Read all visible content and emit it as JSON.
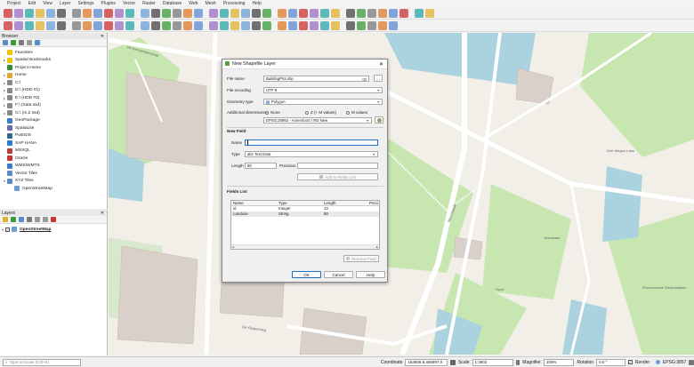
{
  "menu": [
    "Project",
    "Edit",
    "View",
    "Layer",
    "Settings",
    "Plugins",
    "Vector",
    "Raster",
    "Database",
    "Web",
    "Mesh",
    "Processing",
    "Help"
  ],
  "browser": {
    "title": "Browser",
    "items": [
      {
        "label": "Favorites",
        "color": "#f2c200",
        "indent": 0,
        "arrow": ""
      },
      {
        "label": "Spatial Bookmarks",
        "color": "#f2c200",
        "indent": 0,
        "arrow": "▸"
      },
      {
        "label": "Project Home",
        "color": "#3a8e3a",
        "indent": 0,
        "arrow": ""
      },
      {
        "label": "Home",
        "color": "#e3a43a",
        "indent": 0,
        "arrow": "▸"
      },
      {
        "label": "C:\\",
        "color": "#888",
        "indent": 0,
        "arrow": "▸"
      },
      {
        "label": "D:\\ (HDD #1)",
        "color": "#888",
        "indent": 0,
        "arrow": "▸"
      },
      {
        "label": "E:\\ (HDD #2)",
        "color": "#888",
        "indent": 0,
        "arrow": "▸"
      },
      {
        "label": "F:\\ (Sata ssd)",
        "color": "#888",
        "indent": 0,
        "arrow": "▸"
      },
      {
        "label": "G:\\ (m.2 ssd)",
        "color": "#888",
        "indent": 0,
        "arrow": "▸"
      },
      {
        "label": "GeoPackage",
        "color": "#3d7bc4",
        "indent": 0,
        "arrow": ""
      },
      {
        "label": "SpatiaLite",
        "color": "#6b6bb5",
        "indent": 0,
        "arrow": ""
      },
      {
        "label": "PostGIS",
        "color": "#336791",
        "indent": 0,
        "arrow": ""
      },
      {
        "label": "SAP HANA",
        "color": "#2a7ad1",
        "indent": 0,
        "arrow": ""
      },
      {
        "label": "MSSQL",
        "color": "#b83d3d",
        "indent": 0,
        "arrow": ""
      },
      {
        "label": "Oracle",
        "color": "#c33",
        "indent": 0,
        "arrow": ""
      },
      {
        "label": "WMS/WMTS",
        "color": "#3a7cc9",
        "indent": 0,
        "arrow": ""
      },
      {
        "label": "Vector Tiles",
        "color": "#5b8ad1",
        "indent": 0,
        "arrow": ""
      },
      {
        "label": "XYZ Tiles",
        "color": "#5b8ad1",
        "indent": 0,
        "arrow": "▾"
      },
      {
        "label": "OpenStreetMap",
        "color": "#6a9fd8",
        "indent": 1,
        "arrow": ""
      }
    ]
  },
  "layers": {
    "title": "Layers",
    "items": [
      {
        "label": "OpenStreetMap",
        "checked": true
      }
    ]
  },
  "dialog": {
    "title": "New Shapefile Layer",
    "file_name_label": "File name",
    "file_name_value": "BuildingPlot.shp",
    "file_encoding_label": "File encoding",
    "file_encoding_value": "UTF-8",
    "geometry_type_label": "Geometry type",
    "geometry_type_value": "Polygon",
    "additional_dimensions_label": "Additional dimensions",
    "dim_none": "None",
    "dim_z": "Z (+ M values)",
    "dim_m": "M values",
    "crs_value": "EPSG:28992 - Amersfoort / RD New",
    "new_field_section": "New Field",
    "name_label": "Name",
    "name_value": "",
    "type_label": "Type",
    "type_value": "abc  Text Data",
    "length_label": "Length",
    "length_value": "80",
    "precision_label": "Precision",
    "precision_value": "",
    "add_to_fields_label": "Add to Fields List",
    "fields_list_section": "Fields List",
    "columns": [
      "Name",
      "Type",
      "Length",
      "Preci"
    ],
    "rows": [
      [
        "id",
        "Integer",
        "10",
        ""
      ],
      [
        "Landuse",
        "String",
        "80",
        ""
      ]
    ],
    "remove_field_label": "Remove Field",
    "ok_label": "OK",
    "cancel_label": "Cancel",
    "help_label": "Help"
  },
  "status": {
    "locate_placeholder": "Type to locate (Ctrl+K)",
    "coordinate_label": "Coordinate",
    "coordinate_value": "153508.8,465897.0",
    "scale_label": "Scale",
    "scale_value": "1:3602",
    "magnifier_label": "Magnifier",
    "magnifier_value": "100%",
    "rotation_label": "Rotation",
    "rotation_value": "0.0 °",
    "render_label": "Render",
    "crs_label": "EPSG:3857"
  },
  "map_labels": [
    "De Kempenaerstraat",
    "Mauritskade",
    "De Klopperweg",
    "Drie Wegen Laan",
    "Buurtpark",
    "Sport",
    "Ekonomische Werkplaatsen"
  ],
  "colors": {
    "accent": "#1e6fc7",
    "park": "#c8e6b0",
    "water": "#aad3df",
    "building": "#d9d0c9",
    "road": "#ffffff"
  }
}
